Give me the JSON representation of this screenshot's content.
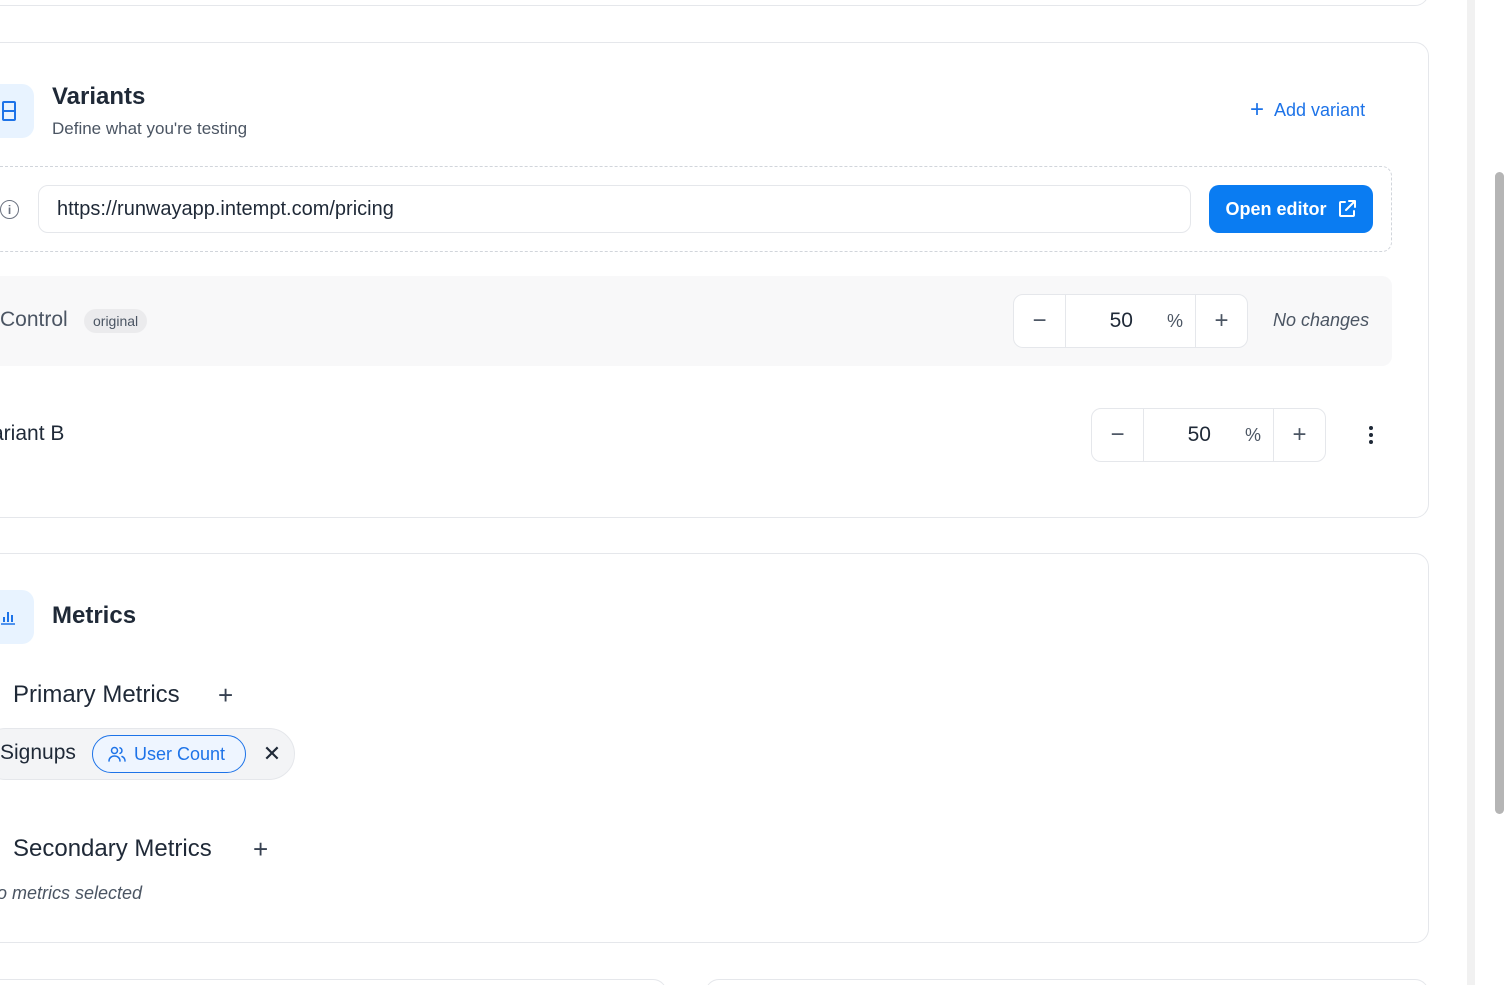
{
  "variants": {
    "title": "Variants",
    "subtitle": "Define what you're testing",
    "add_variant_label": "Add variant",
    "url_value": "https://runwayapp.intempt.com/pricing",
    "open_editor_label": "Open editor",
    "rows": [
      {
        "name": "Control",
        "badge": "original",
        "percent": "50",
        "percent_sign": "%",
        "status": "No changes"
      },
      {
        "name": "ariant B",
        "percent": "50",
        "percent_sign": "%"
      }
    ]
  },
  "metrics": {
    "title": "Metrics",
    "primary_heading": "Primary Metrics",
    "primary_items": [
      {
        "name": "Signups",
        "type_label": "User Count"
      }
    ],
    "secondary_heading": "Secondary Metrics",
    "secondary_empty": "o metrics selected"
  },
  "colors": {
    "accent": "#0a7cf2",
    "accent_text": "#1d73e8",
    "icon_bg": "#e8f3ff"
  }
}
